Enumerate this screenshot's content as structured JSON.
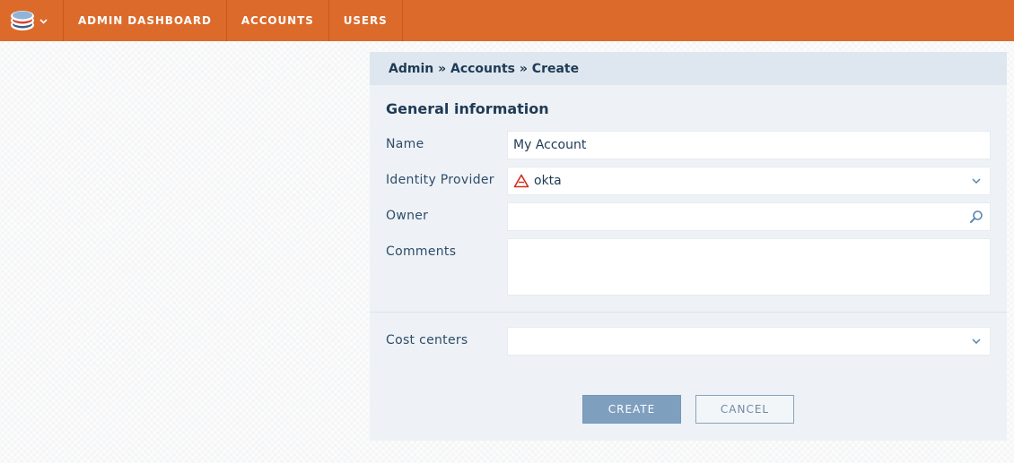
{
  "nav": {
    "items": [
      {
        "label": "ADMIN DASHBOARD"
      },
      {
        "label": "ACCOUNTS"
      },
      {
        "label": "USERS"
      }
    ]
  },
  "breadcrumb": "Admin » Accounts » Create",
  "form": {
    "section_title": "General information",
    "name": {
      "label": "Name",
      "value": "My Account"
    },
    "identity_provider": {
      "label": "Identity Provider",
      "value": "okta"
    },
    "owner": {
      "label": "Owner",
      "value": ""
    },
    "comments": {
      "label": "Comments",
      "value": ""
    },
    "cost_centers": {
      "label": "Cost centers",
      "value": ""
    }
  },
  "buttons": {
    "create": "CREATE",
    "cancel": "CANCEL"
  },
  "colors": {
    "topbar": "#dc6a2a",
    "panel": "#eef2f6",
    "breadcrumb_bg": "#dee7ef",
    "primary_button": "#7f9fbf",
    "okta_icon": "#d52b1e"
  },
  "icons": {
    "app_logo": "stacked-layers-icon",
    "menu_caret": "chevron-down-icon",
    "provider": "okta-logo-icon",
    "dropdown": "chevron-down-icon",
    "search": "search-icon"
  }
}
